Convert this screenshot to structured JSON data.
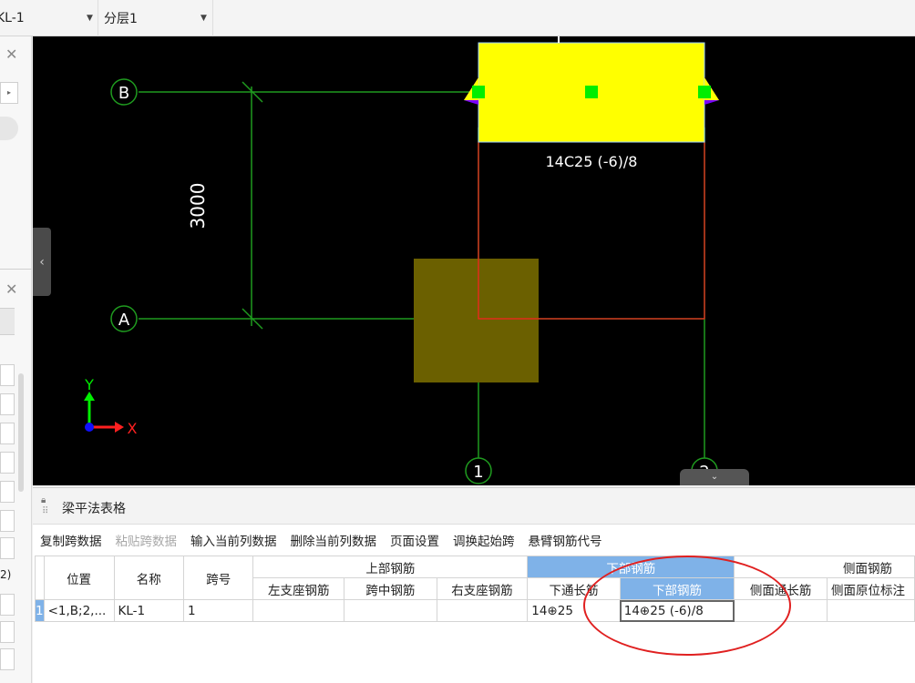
{
  "toolbar": {
    "element_value": "KL-1",
    "layer_value": "分层1"
  },
  "canvas": {
    "axes": {
      "B": "B",
      "A": "A",
      "one": "1",
      "two": "2"
    },
    "dimension": "3000",
    "rebar_annotation": "14C25 (-6)/8",
    "ucs": {
      "y": "Y",
      "x": "X"
    },
    "colors": {
      "beam": "#ffff00",
      "column": "#6b6000",
      "grid": "#1f9b1f",
      "beam_outline": "#ff2020"
    }
  },
  "left_panel": {
    "stub_label": "2)"
  },
  "bottom_panel": {
    "title": "梁平法表格",
    "toolbar": [
      {
        "label": "复制跨数据",
        "enabled": true
      },
      {
        "label": "粘贴跨数据",
        "enabled": false
      },
      {
        "label": "输入当前列数据",
        "enabled": true
      },
      {
        "label": "删除当前列数据",
        "enabled": true
      },
      {
        "label": "页面设置",
        "enabled": true
      },
      {
        "label": "调换起始跨",
        "enabled": true
      },
      {
        "label": "悬臂钢筋代号",
        "enabled": true
      }
    ],
    "table": {
      "groups": {
        "top": "上部钢筋",
        "bottom": "下部钢筋",
        "side": "侧面钢筋"
      },
      "headers": {
        "position": "位置",
        "name": "名称",
        "span": "跨号",
        "left_support": "左支座钢筋",
        "mid_span": "跨中钢筋",
        "right_support": "右支座钢筋",
        "bottom_through": "下通长筋",
        "bottom_rebar": "下部钢筋",
        "side_through": "侧面通长筋",
        "side_original": "侧面原位标注"
      },
      "rows": [
        {
          "num": "1",
          "position": "<1,B;2,...",
          "name": "KL-1",
          "span": "1",
          "left_support": "",
          "mid_span": "",
          "right_support": "",
          "bottom_through": "14⊕25",
          "bottom_rebar": "14⊕25 (-6)/8",
          "side_through": "",
          "side_original": ""
        }
      ]
    }
  }
}
